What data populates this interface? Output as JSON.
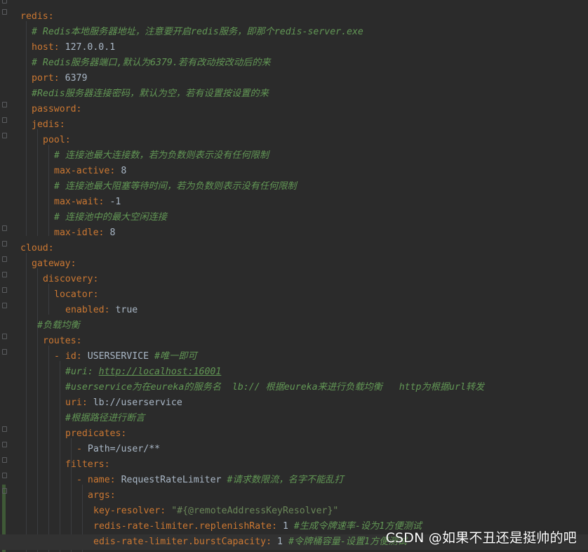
{
  "lines": [
    {
      "indent": 0,
      "key": "",
      "value": "",
      "comment": "",
      "partial": true
    },
    {
      "indent": 0,
      "key": "redis",
      "value": "",
      "comment": ""
    },
    {
      "indent": 2,
      "key": "",
      "value": "",
      "comment": "# Redis本地服务器地址，注意要开启redis服务，即那个redis-server.exe"
    },
    {
      "indent": 2,
      "key": "host",
      "value": "127.0.0.1",
      "comment": ""
    },
    {
      "indent": 2,
      "key": "",
      "value": "",
      "comment": "# Redis服务器端口,默认为6379.若有改动按改动后的来"
    },
    {
      "indent": 2,
      "key": "port",
      "value": "6379",
      "comment": ""
    },
    {
      "indent": 2,
      "key": "",
      "value": "",
      "comment": "#Redis服务器连接密码，默认为空，若有设置按设置的来"
    },
    {
      "indent": 2,
      "key": "password",
      "value": "",
      "comment": ""
    },
    {
      "indent": 2,
      "key": "jedis",
      "value": "",
      "comment": ""
    },
    {
      "indent": 4,
      "key": "pool",
      "value": "",
      "comment": ""
    },
    {
      "indent": 6,
      "key": "",
      "value": "",
      "comment": "# 连接池最大连接数，若为负数则表示没有任何限制"
    },
    {
      "indent": 6,
      "key": "max-active",
      "value": "8",
      "comment": ""
    },
    {
      "indent": 6,
      "key": "",
      "value": "",
      "comment": "# 连接池最大阻塞等待时间，若为负数则表示没有任何限制"
    },
    {
      "indent": 6,
      "key": "max-wait",
      "value": "-1",
      "comment": ""
    },
    {
      "indent": 6,
      "key": "",
      "value": "",
      "comment": "# 连接池中的最大空闲连接"
    },
    {
      "indent": 6,
      "key": "max-idle",
      "value": "8",
      "comment": ""
    },
    {
      "indent": 0,
      "key": "cloud",
      "value": "",
      "comment": ""
    },
    {
      "indent": 2,
      "key": "gateway",
      "value": "",
      "comment": ""
    },
    {
      "indent": 4,
      "key": "discovery",
      "value": "",
      "comment": ""
    },
    {
      "indent": 6,
      "key": "locator",
      "value": "",
      "comment": ""
    },
    {
      "indent": 8,
      "key": "enabled",
      "value": "true",
      "comment": ""
    },
    {
      "indent": 3,
      "key": "",
      "value": "",
      "comment": "#负载均衡"
    },
    {
      "indent": 4,
      "key": "routes",
      "value": "",
      "comment": ""
    },
    {
      "indent": 6,
      "dash": true,
      "key": "id",
      "value": "USERSERVICE",
      "comment": "#唯一即可"
    },
    {
      "indent": 8,
      "key": "",
      "value": "",
      "comment": "#uri: ",
      "url": "http://localhost:16001"
    },
    {
      "indent": 8,
      "key": "",
      "value": "",
      "comment": "#userservice为在eureka的服务名  lb:// 根据eureka来进行负载均衡   http为根据url转发"
    },
    {
      "indent": 8,
      "key": "uri",
      "value": "lb://userservice",
      "comment": ""
    },
    {
      "indent": 8,
      "key": "",
      "value": "",
      "comment": "#根据路径进行断言"
    },
    {
      "indent": 8,
      "key": "predicates",
      "value": "",
      "comment": ""
    },
    {
      "indent": 10,
      "dash": true,
      "plain": "Path=/user/**"
    },
    {
      "indent": 8,
      "key": "filters",
      "value": "",
      "comment": ""
    },
    {
      "indent": 10,
      "dash": true,
      "key": "name",
      "value": "RequestRateLimiter",
      "comment": "#请求数限流，名字不能乱打"
    },
    {
      "indent": 12,
      "key": "args",
      "value": "",
      "comment": ""
    },
    {
      "indent": 13,
      "key": "key-resolver",
      "str": "\"#{@remoteAddressKeyResolver}\"",
      "comment": ""
    },
    {
      "indent": 13,
      "key": "redis-rate-limiter.replenishRate",
      "value": "1",
      "comment": "#生成令牌速率-设为1方便测试"
    },
    {
      "indent": 13,
      "key": "edis-rate-limiter.burstCapacity",
      "value": "1",
      "comment": "#令牌桶容量-设置1方便测试",
      "current": true
    }
  ],
  "watermark": "CSDN @如果不丑还是挺帅的吧"
}
